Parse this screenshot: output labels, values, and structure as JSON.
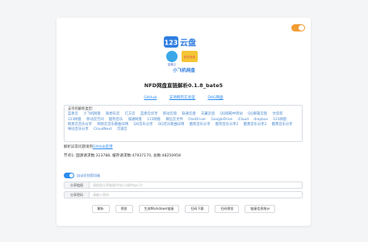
{
  "app": {
    "title": "NFD网盘直链解析0.1.8_bate5",
    "logo_text": {
      "main": "云盘",
      "badge": "123",
      "sub": "小飞机网盘",
      "tag1": "蓝奏云",
      "tag2": "奶牛快传"
    }
  },
  "links": [
    {
      "label": "GitHub"
    },
    {
      "label": "支持网页实验室"
    },
    {
      "label": "DAG网盘"
    }
  ],
  "types": {
    "label": "支持的解析类型:",
    "items": [
      "蓝奏云",
      "小飞机网盘",
      "联想乐云",
      "亿方云",
      "蓝奏云优享",
      "移动云盘",
      "联通云盘",
      "天翼云盘",
      "QQ邮箱中转站",
      "QQ邮箱云盘",
      "文叔叔",
      "123网盘",
      "移动云空间",
      "酷狗音乐",
      "城通网盘",
      "115网盘",
      "微信云文件",
      "OneDriver",
      "GoogleDrive",
      "iCloud",
      "dropbox",
      "123网盘",
      "网易云音乐分享",
      "网易云音乐歌曲详情",
      "QQ音乐分享",
      "QQ音乐歌曲详情",
      "酷狗音乐分享",
      "酷狗音乐分享2",
      "酷我音乐分享2",
      "酷我音乐分享",
      "咪咕音乐分享",
      "CloudNext",
      "可道云"
    ]
  },
  "feedback": {
    "text": "解析异常问题请到",
    "link": "GitHub反馈"
  },
  "node_info": "节点1: 国源请求数:313788, 缓存请求数:47937170, 总数:48250958",
  "api_switch": {
    "label": "自动识别剪切板",
    "on": true
  },
  "inputs": {
    "share_link": {
      "label": "分享链接",
      "placeholder": "请粘贴分享链接(http://或https://)"
    },
    "share_password": {
      "label": "分享密码",
      "placeholder": "请输入密码"
    }
  },
  "buttons": [
    "解析",
    "预览",
    "生成Markdown链接",
    "扫码下载",
    "扫码预览",
    "链接信息统计"
  ],
  "colors": {
    "accent": "#2d8cf0",
    "toggle": "#f39c33"
  }
}
